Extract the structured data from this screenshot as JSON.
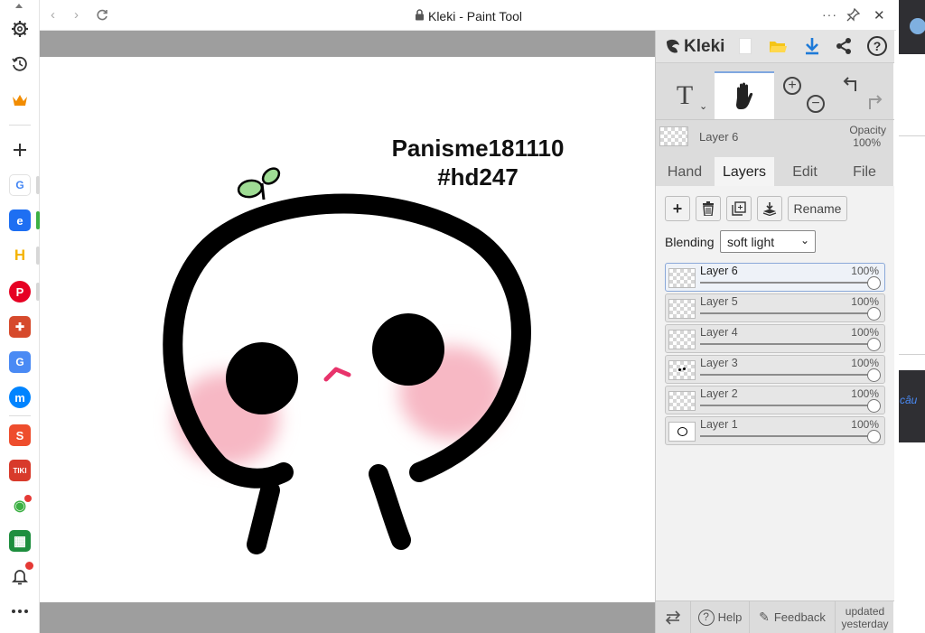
{
  "window": {
    "title": "Kleki - Paint Tool",
    "more_icon": "ellipsis-icon",
    "pin_icon": "pin-icon",
    "close_icon": "close-icon"
  },
  "left_sidebar": {
    "items": [
      {
        "name": "settings",
        "icon": "gear-icon"
      },
      {
        "name": "history",
        "icon": "history-icon"
      },
      {
        "name": "crown",
        "icon": "crown-icon"
      },
      {
        "name": "add",
        "icon": "plus-icon"
      },
      {
        "name": "google",
        "label": "G",
        "color": "#ffffff"
      },
      {
        "name": "ext-blue",
        "label": "e",
        "color": "#1e6ff2"
      },
      {
        "name": "ext-h",
        "label": "H",
        "color": "#f5b400"
      },
      {
        "name": "pinterest",
        "label": "P",
        "color": "#e60023"
      },
      {
        "name": "shield-ext",
        "label": "✚",
        "color": "#d64a2c"
      },
      {
        "name": "translate",
        "label": "G",
        "color": "#4a8af4"
      },
      {
        "name": "messenger",
        "label": "m",
        "color": "#0084ff"
      },
      {
        "name": "shopee",
        "label": "S",
        "color": "#ee4d2d"
      },
      {
        "name": "tiki",
        "label": "TIKI",
        "color": "#d83a2b"
      },
      {
        "name": "maps-ext",
        "label": "◉",
        "color": "#3cb043"
      },
      {
        "name": "sheet-ext",
        "label": "▦",
        "color": "#1e8e3e"
      }
    ],
    "bell_icon": "bell-icon",
    "more_icon": "more-icon"
  },
  "panel": {
    "logo": "Kleki",
    "top_icons": [
      "new-file-icon",
      "open-folder-icon",
      "download-icon",
      "share-icon",
      "help-icon"
    ],
    "current_layer": "Layer 6",
    "opacity_label": "Opacity",
    "opacity_value": "100%",
    "tabs": [
      {
        "label": "Hand",
        "active": false
      },
      {
        "label": "Layers",
        "active": true
      },
      {
        "label": "Edit",
        "active": false
      },
      {
        "label": "File",
        "active": false
      }
    ],
    "rename_label": "Rename",
    "blending_label": "Blending",
    "blending_value": "soft light",
    "layers": [
      {
        "name": "Layer 6",
        "opacity": "100%",
        "active": true
      },
      {
        "name": "Layer 5",
        "opacity": "100%",
        "active": false
      },
      {
        "name": "Layer 4",
        "opacity": "100%",
        "active": false
      },
      {
        "name": "Layer 3",
        "opacity": "100%",
        "active": false
      },
      {
        "name": "Layer 2",
        "opacity": "100%",
        "active": false
      },
      {
        "name": "Layer 1",
        "opacity": "100%",
        "active": false
      }
    ],
    "footer": {
      "help_label": "Help",
      "feedback_label": "Feedback",
      "updated_line1": "updated",
      "updated_line2": "yesterday"
    }
  },
  "canvas": {
    "text_line1": "Panisme181110",
    "text_line2": "#hd247",
    "accent_pink": "#f7b8c4",
    "sprout_green": "#9fdc94"
  },
  "right_strip": {
    "text": "câu"
  }
}
